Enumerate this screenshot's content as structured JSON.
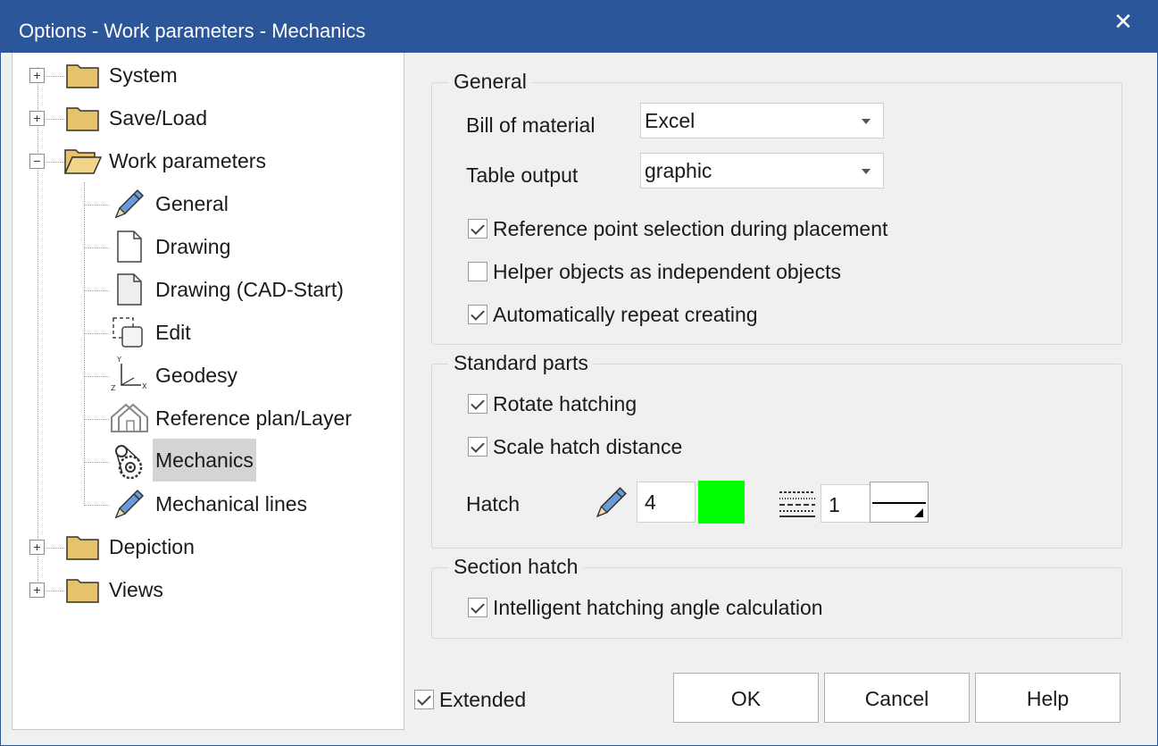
{
  "window": {
    "title": "Options - Work parameters - Mechanics",
    "close_glyph": "✕"
  },
  "tree": {
    "items": [
      {
        "label": "System",
        "icon": "folder-closed-icon",
        "expander": "+"
      },
      {
        "label": "Save/Load",
        "icon": "folder-closed-icon",
        "expander": "+"
      },
      {
        "label": "Work parameters",
        "icon": "folder-open-icon",
        "expander": "−"
      },
      {
        "label": "General",
        "icon": "pencil-icon"
      },
      {
        "label": "Drawing",
        "icon": "document-icon"
      },
      {
        "label": "Drawing (CAD-Start)",
        "icon": "document-icon"
      },
      {
        "label": "Edit",
        "icon": "edit-selection-icon"
      },
      {
        "label": "Geodesy",
        "icon": "axes-icon"
      },
      {
        "label": "Reference plan/Layer",
        "icon": "house-layers-icon"
      },
      {
        "label": "Mechanics",
        "icon": "gear-chain-icon",
        "selected": true
      },
      {
        "label": "Mechanical lines",
        "icon": "pencil-icon"
      },
      {
        "label": "Depiction",
        "icon": "folder-closed-icon",
        "expander": "+"
      },
      {
        "label": "Views",
        "icon": "folder-closed-icon",
        "expander": "+"
      }
    ]
  },
  "general": {
    "title": "General",
    "bom_label": "Bill of material",
    "bom_value": "Excel",
    "table_label": "Table output",
    "table_value": "graphic",
    "checks": [
      {
        "label": "Reference point selection during placement",
        "checked": true
      },
      {
        "label": "Helper objects as independent objects",
        "checked": false
      },
      {
        "label": "Automatically repeat creating",
        "checked": true
      }
    ]
  },
  "standard": {
    "title": "Standard parts",
    "checks": [
      {
        "label": "Rotate hatching",
        "checked": true
      },
      {
        "label": "Scale hatch distance",
        "checked": true
      }
    ],
    "hatch_label": "Hatch",
    "pen_value": "4",
    "color": "#00ff00",
    "line_value": "1"
  },
  "section": {
    "title": "Section hatch",
    "checks": [
      {
        "label": "Intelligent hatching angle calculation",
        "checked": true
      }
    ]
  },
  "footer": {
    "extended_label": "Extended",
    "extended_checked": true,
    "ok": "OK",
    "cancel": "Cancel",
    "help": "Help"
  }
}
